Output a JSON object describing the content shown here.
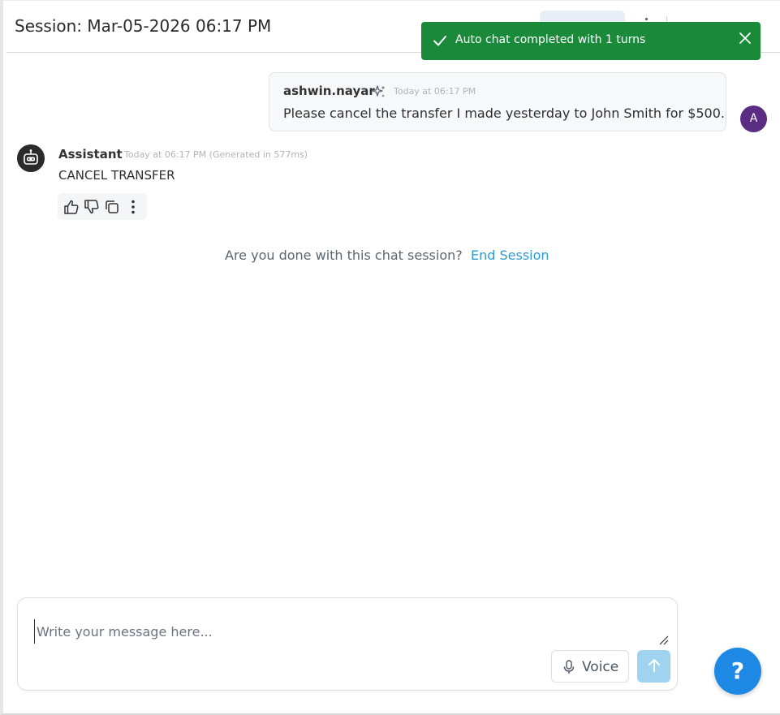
{
  "header": {
    "title": "Session: Mar-05-2026 06:17 PM"
  },
  "toast": {
    "message": "Auto chat completed with 1 turns",
    "icon": "check-icon",
    "close_icon": "close-icon",
    "color": "#1a8a3a"
  },
  "messages": {
    "user": {
      "name": "ashwin.nayar",
      "time": "Today at 06:17 PM",
      "text": "Please cancel the transfer I made yesterday to John Smith for $500.",
      "avatar_letter": "A",
      "avatar_color": "#5b2d82"
    },
    "assistant": {
      "name": "Assistant",
      "time": "Today at 06:17 PM (Generated in 577ms)",
      "text": "CANCEL TRANSFER",
      "actions": [
        "thumbs-up-icon",
        "thumbs-down-icon",
        "copy-icon",
        "more-vertical-icon"
      ]
    }
  },
  "end_session": {
    "question": "Are you done with this chat session?",
    "link": "End Session",
    "link_color": "#2d9bd0"
  },
  "composer": {
    "placeholder": "Write your message here...",
    "voice_label": "Voice"
  },
  "help": {
    "label": "?"
  }
}
